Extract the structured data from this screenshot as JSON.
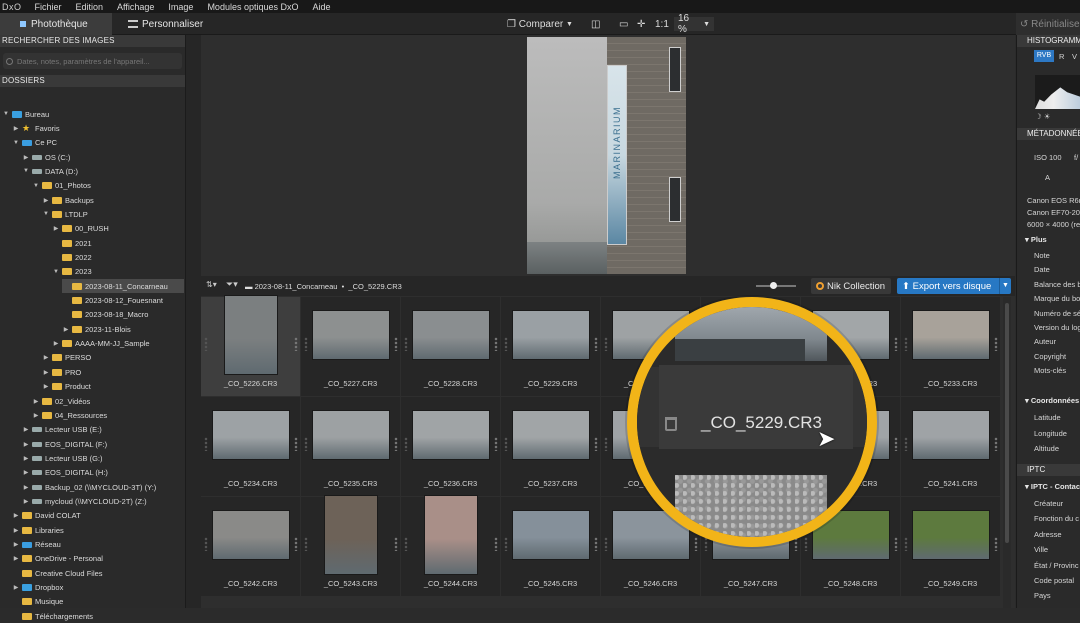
{
  "menu": {
    "logo": "DxO",
    "items": [
      "Fichier",
      "Edition",
      "Affichage",
      "Image",
      "Modules optiques DxO",
      "Aide"
    ]
  },
  "tabs": {
    "photo": "Photothèque",
    "customize": "Personnaliser"
  },
  "toolbar": {
    "compare": "Comparer",
    "ratio": "1:1",
    "zoom": "16 %",
    "reset": "Réinitialiser"
  },
  "left": {
    "search_header": "RECHERCHER DES IMAGES",
    "search_placeholder": "Dates, notes, paramètres de l'appareil...",
    "folders_header": "DOSSIERS",
    "tree": [
      {
        "label": "Bureau",
        "depth": 0,
        "arrow": "▼",
        "icon": "blue"
      },
      {
        "label": "Favoris",
        "depth": 1,
        "arrow": "▶",
        "icon": "star"
      },
      {
        "label": "Ce PC",
        "depth": 1,
        "arrow": "▼",
        "icon": "pc"
      },
      {
        "label": "OS (C:)",
        "depth": 2,
        "arrow": "▶",
        "icon": "drive"
      },
      {
        "label": "DATA (D:)",
        "depth": 2,
        "arrow": "▼",
        "icon": "drive"
      },
      {
        "label": "01_Photos",
        "depth": 3,
        "arrow": "▼",
        "icon": "folder"
      },
      {
        "label": "Backups",
        "depth": 4,
        "arrow": "▶",
        "icon": "folder"
      },
      {
        "label": "LTDLP",
        "depth": 4,
        "arrow": "▼",
        "icon": "folder"
      },
      {
        "label": "00_RUSH",
        "depth": 5,
        "arrow": "▶",
        "icon": "folder"
      },
      {
        "label": "2021",
        "depth": 5,
        "arrow": "",
        "icon": "folder"
      },
      {
        "label": "2022",
        "depth": 5,
        "arrow": "",
        "icon": "folder"
      },
      {
        "label": "2023",
        "depth": 5,
        "arrow": "▼",
        "icon": "folder"
      },
      {
        "label": "2023-08-11_Concarneau",
        "depth": 6,
        "arrow": "",
        "icon": "folder",
        "selected": true
      },
      {
        "label": "2023-08-12_Fouesnant",
        "depth": 6,
        "arrow": "",
        "icon": "folder"
      },
      {
        "label": "2023-08-18_Macro",
        "depth": 6,
        "arrow": "",
        "icon": "folder"
      },
      {
        "label": "2023-11-Blois",
        "depth": 6,
        "arrow": "▶",
        "icon": "folder"
      },
      {
        "label": "AAAA-MM-JJ_Sample",
        "depth": 5,
        "arrow": "▶",
        "icon": "folder"
      },
      {
        "label": "PERSO",
        "depth": 4,
        "arrow": "▶",
        "icon": "folder"
      },
      {
        "label": "PRO",
        "depth": 4,
        "arrow": "▶",
        "icon": "folder"
      },
      {
        "label": "Product",
        "depth": 4,
        "arrow": "▶",
        "icon": "folder"
      },
      {
        "label": "02_Vidéos",
        "depth": 3,
        "arrow": "▶",
        "icon": "folder"
      },
      {
        "label": "04_Ressources",
        "depth": 3,
        "arrow": "▶",
        "icon": "folder"
      },
      {
        "label": "Lecteur USB (E:)",
        "depth": 2,
        "arrow": "▶",
        "icon": "drive"
      },
      {
        "label": "EOS_DIGITAL (F:)",
        "depth": 2,
        "arrow": "▶",
        "icon": "drive"
      },
      {
        "label": "Lecteur USB (G:)",
        "depth": 2,
        "arrow": "▶",
        "icon": "drive"
      },
      {
        "label": "EOS_DIGITAL (H:)",
        "depth": 2,
        "arrow": "▶",
        "icon": "drive"
      },
      {
        "label": "Backup_02 (\\\\MYCLOUD-3T) (Y:)",
        "depth": 2,
        "arrow": "▶",
        "icon": "drive"
      },
      {
        "label": "mycloud (\\\\MYCLOUD-2T) (Z:)",
        "depth": 2,
        "arrow": "▶",
        "icon": "drive"
      },
      {
        "label": "David COLAT",
        "depth": 1,
        "arrow": "▶",
        "icon": "folder"
      },
      {
        "label": "Libraries",
        "depth": 1,
        "arrow": "▶",
        "icon": "folder"
      },
      {
        "label": "Réseau",
        "depth": 1,
        "arrow": "▶",
        "icon": "pc"
      },
      {
        "label": "OneDrive - Personal",
        "depth": 1,
        "arrow": "▶",
        "icon": "folder"
      },
      {
        "label": "Creative Cloud Files",
        "depth": 1,
        "arrow": "",
        "icon": "folder"
      },
      {
        "label": "Dropbox",
        "depth": 1,
        "arrow": "▶",
        "icon": "blue"
      },
      {
        "label": "Musique",
        "depth": 1,
        "arrow": "",
        "icon": "folder"
      },
      {
        "label": "Téléchargements",
        "depth": 1,
        "arrow": "",
        "icon": "folder"
      }
    ]
  },
  "preview": {
    "banner_text": "MARINARIUM"
  },
  "filmstrip": {
    "path": "2023-08-11_Concarneau",
    "file": "_CO_5229.CR3",
    "nik": "Nik Collection",
    "export": "Export vers disque"
  },
  "thumbs": [
    "_CO_5226.CR3",
    "_CO_5227.CR3",
    "_CO_5228.CR3",
    "_CO_5229.CR3",
    "_CO_5230.CR3",
    "_CO_5231.CR3",
    "_CO_5232.CR3",
    "_CO_5233.CR3",
    "_CO_5234.CR3",
    "_CO_5235.CR3",
    "_CO_5236.CR3",
    "_CO_5237.CR3",
    "_CO_5238.CR3",
    "_CO_5239.CR3",
    "_CO_5240.CR3",
    "_CO_5241.CR3",
    "_CO_5242.CR3",
    "_CO_5243.CR3",
    "_CO_5244.CR3",
    "_CO_5245.CR3",
    "_CO_5246.CR3",
    "_CO_5247.CR3",
    "_CO_5248.CR3",
    "_CO_5249.CR3"
  ],
  "thumb_colors": [
    "#7b7f80",
    "#8d9090",
    "#8a8e90",
    "#9aa0a4",
    "#9ea2a4",
    "#a3a7aa",
    "#a2a6a8",
    "#a8a29a",
    "#9da2a5",
    "#9da1a3",
    "#a0a4a6",
    "#a1a5a7",
    "#9fa3a6",
    "#a1a5a8",
    "#a0a4a7",
    "#9fa3a6",
    "#8a8a88",
    "#6d6258",
    "#a98f88",
    "#85909a",
    "#8b949c",
    "#8c9298",
    "#5d7a3e",
    "#5d7a3e"
  ],
  "magnifier": {
    "caption": "_CO_5229.CR3",
    "accent": "#f2b418"
  },
  "right": {
    "histogram": "HISTOGRAMME",
    "rvb": "RVB",
    "r": "R",
    "v": "V",
    "metadata": "MÉTADONNÉES",
    "iso": "ISO 100",
    "f": "f/",
    "a": "A",
    "camera": "Canon EOS R6m",
    "lens": "Canon EF70-200",
    "dims": "6000 × 4000 (re",
    "plus": "Plus",
    "fields": [
      "Note",
      "Date",
      "Balance des b",
      "Marque du bo",
      "Numéro de sé",
      "Version du log",
      "Auteur",
      "Copyright",
      "Mots-clés"
    ],
    "coords": "Coordonnées",
    "coord_fields": [
      "Latitude",
      "Longitude",
      "Altitude"
    ],
    "iptc": "IPTC",
    "iptc_contact": "IPTC - Contac",
    "iptc_fields": [
      "Créateur",
      "Fonction du c",
      "Adresse",
      "Ville",
      "État / Provinc",
      "Code postal",
      "Pays"
    ]
  }
}
